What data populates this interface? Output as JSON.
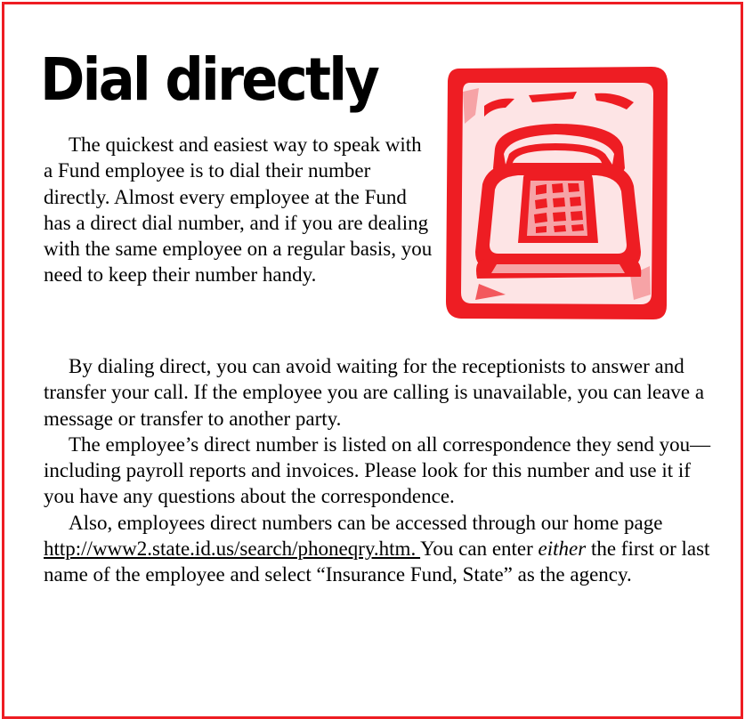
{
  "title": "Dial directly",
  "colors": {
    "border": "#ee1d23",
    "phone_red": "#ee1d23",
    "phone_pink": "#f6a3a6",
    "phone_light": "#fde4e5"
  },
  "graphic": {
    "icon": "telephone-icon"
  },
  "paragraphs": {
    "p1": "The quickest and easiest way to speak with a Fund employee is to dial their number directly.  Almost every employee at the Fund has a direct dial number, and if you are dealing with the same employee on a regular basis, you need to keep their number handy.",
    "p2": "By dialing direct, you can avoid waiting for the receptionists to answer and transfer your call.  If the employee you are calling is unavailable, you can leave a message or transfer to another party.",
    "p3": "The employee’s direct number is listed on all correspondence they send you—including payroll reports and invoices.  Please look for this number and use it if you have any questions about the correspondence.",
    "p4": {
      "before_link": "Also, employees direct numbers can be accessed through our home page ",
      "link": "http://www2.state.id.us/search/phoneqry.htm. ",
      "after_link": "You can enter ",
      "emphasis": "either",
      "end": "  the first or last name of the employee and select “Insurance Fund, State” as the agency."
    }
  }
}
